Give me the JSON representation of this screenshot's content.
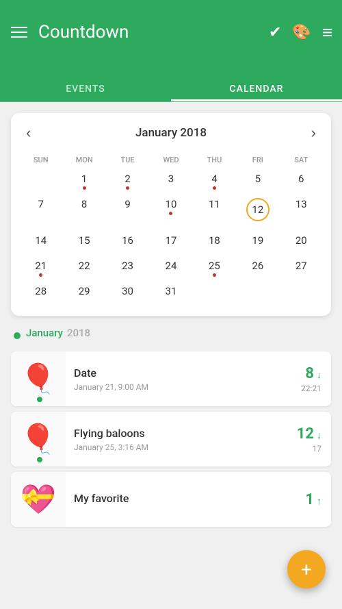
{
  "header": {
    "title": "Countdown",
    "icons": {
      "menu": "☰",
      "check": "✔",
      "palette": "🎨",
      "sort": "≡"
    }
  },
  "tabs": [
    {
      "id": "events",
      "label": "EVENTS",
      "active": false
    },
    {
      "id": "calendar",
      "label": "CALENDAR",
      "active": true
    }
  ],
  "calendar": {
    "month_title": "January 2018",
    "weekdays": [
      "SUN",
      "MON",
      "TUE",
      "WED",
      "THU",
      "FRI",
      "SAT"
    ],
    "today": 12,
    "days": [
      {
        "num": "",
        "dot": false
      },
      {
        "num": "1",
        "dot": true
      },
      {
        "num": "2",
        "dot": true
      },
      {
        "num": "3",
        "dot": false
      },
      {
        "num": "4",
        "dot": true
      },
      {
        "num": "5",
        "dot": false
      },
      {
        "num": "6",
        "dot": false
      },
      {
        "num": "7",
        "dot": false
      },
      {
        "num": "8",
        "dot": false
      },
      {
        "num": "9",
        "dot": false
      },
      {
        "num": "10",
        "dot": true
      },
      {
        "num": "11",
        "dot": false
      },
      {
        "num": "12",
        "dot": false
      },
      {
        "num": "13",
        "dot": false
      },
      {
        "num": "14",
        "dot": false
      },
      {
        "num": "15",
        "dot": false
      },
      {
        "num": "16",
        "dot": false
      },
      {
        "num": "17",
        "dot": false
      },
      {
        "num": "18",
        "dot": false
      },
      {
        "num": "19",
        "dot": false
      },
      {
        "num": "20",
        "dot": false
      },
      {
        "num": "21",
        "dot": true
      },
      {
        "num": "22",
        "dot": false
      },
      {
        "num": "23",
        "dot": false
      },
      {
        "num": "24",
        "dot": false
      },
      {
        "num": "25",
        "dot": true
      },
      {
        "num": "26",
        "dot": false
      },
      {
        "num": "27",
        "dot": false
      },
      {
        "num": "28",
        "dot": false
      },
      {
        "num": "29",
        "dot": false
      },
      {
        "num": "30",
        "dot": false
      },
      {
        "num": "31",
        "dot": false
      }
    ]
  },
  "events_section": {
    "month": "January",
    "year": "2018",
    "items": [
      {
        "id": "date",
        "title": "Date",
        "date": "January 21, 9:00 AM",
        "count": "8",
        "arrow": "↓",
        "time": "22:21",
        "emoji": "🎈",
        "has_dot": true
      },
      {
        "id": "flying-baloons",
        "title": "Flying baloons",
        "date": "January 25, 3:16 AM",
        "count": "12",
        "arrow": "↓",
        "time": "17",
        "emoji": "🎈",
        "has_dot": true
      },
      {
        "id": "my-favorite",
        "title": "My favorite",
        "date": "",
        "count": "1",
        "arrow": "↑",
        "time": "",
        "emoji": "💝",
        "has_dot": false
      }
    ]
  },
  "fab": {
    "label": "+"
  }
}
